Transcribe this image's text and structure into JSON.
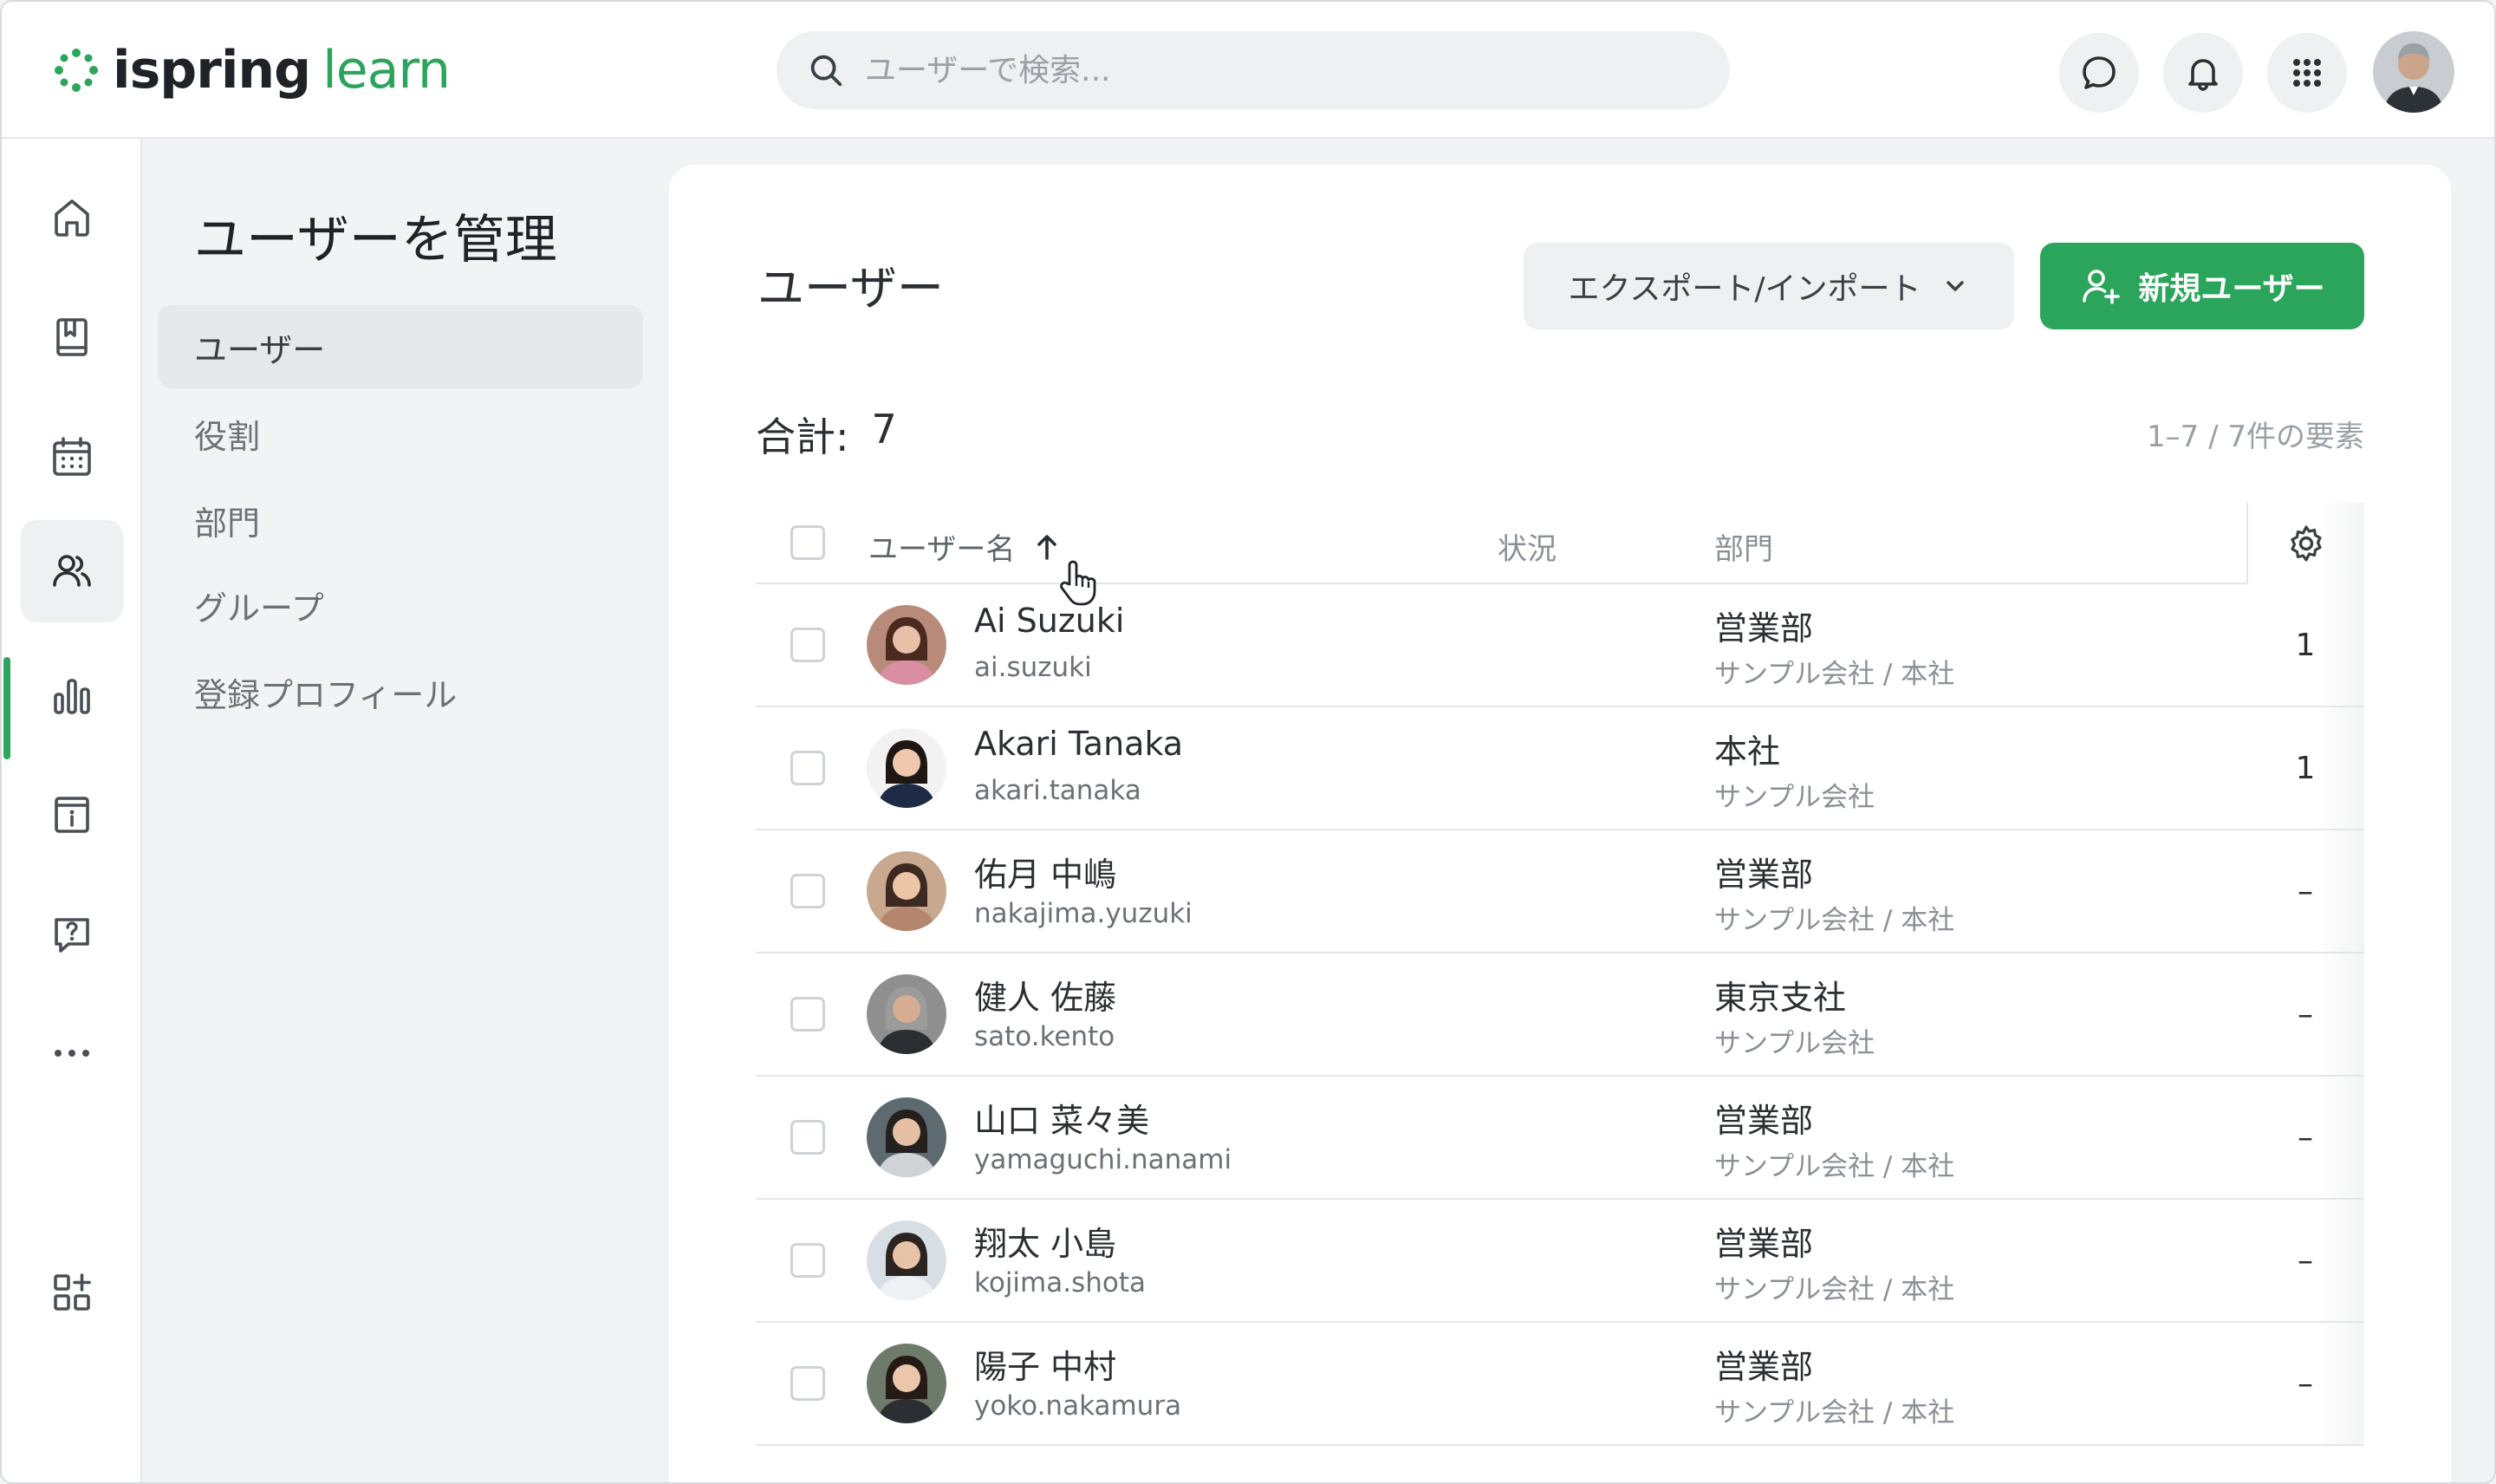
{
  "header": {
    "logo_primary": "ispring",
    "logo_secondary": "learn",
    "search_placeholder": "ユーザーで検索..."
  },
  "brand_color": "#2aa55b",
  "submenu": {
    "title": "ユーザーを管理",
    "items": [
      {
        "label": "ユーザー",
        "active": true
      },
      {
        "label": "役割"
      },
      {
        "label": "部門"
      },
      {
        "label": "グループ"
      },
      {
        "label": "登録プロフィール"
      }
    ]
  },
  "main": {
    "title": "ユーザー",
    "export_label": "エクスポート/インポート",
    "new_user_label": "新規ユーザー",
    "total_label": "合計:",
    "total_value": "7",
    "range_label": "1–7 / 7件の要素",
    "columns": {
      "name": "ユーザー名",
      "status": "状況",
      "department": "部門"
    },
    "rows": [
      {
        "name": "Ai Suzuki",
        "login": "ai.suzuki",
        "dept": "営業部",
        "org": "サンプル会社 / 本社",
        "count": "1"
      },
      {
        "name": "Akari Tanaka",
        "login": "akari.tanaka",
        "dept": "本社",
        "org": "サンプル会社",
        "count": "1"
      },
      {
        "name": "佑月 中嶋",
        "login": "nakajima.yuzuki",
        "dept": "営業部",
        "org": "サンプル会社 / 本社",
        "count": "–"
      },
      {
        "name": "健人 佐藤",
        "login": "sato.kento",
        "dept": "東京支社",
        "org": "サンプル会社",
        "count": "–"
      },
      {
        "name": "山口 菜々美",
        "login": "yamaguchi.nanami",
        "dept": "営業部",
        "org": "サンプル会社 / 本社",
        "count": "–"
      },
      {
        "name": "翔太 小島",
        "login": "kojima.shota",
        "dept": "営業部",
        "org": "サンプル会社 / 本社",
        "count": "–"
      },
      {
        "name": "陽子 中村",
        "login": "yoko.nakamura",
        "dept": "営業部",
        "org": "サンプル会社 / 本社",
        "count": "–"
      }
    ]
  },
  "rail_icons": [
    "home-icon",
    "book-icon",
    "calendar-icon",
    "users-icon",
    "chart-icon",
    "info-icon",
    "question-icon",
    "more-icon",
    "apps-add-icon"
  ],
  "header_icons": [
    "chat-icon",
    "bell-icon",
    "apps-grid-icon"
  ]
}
